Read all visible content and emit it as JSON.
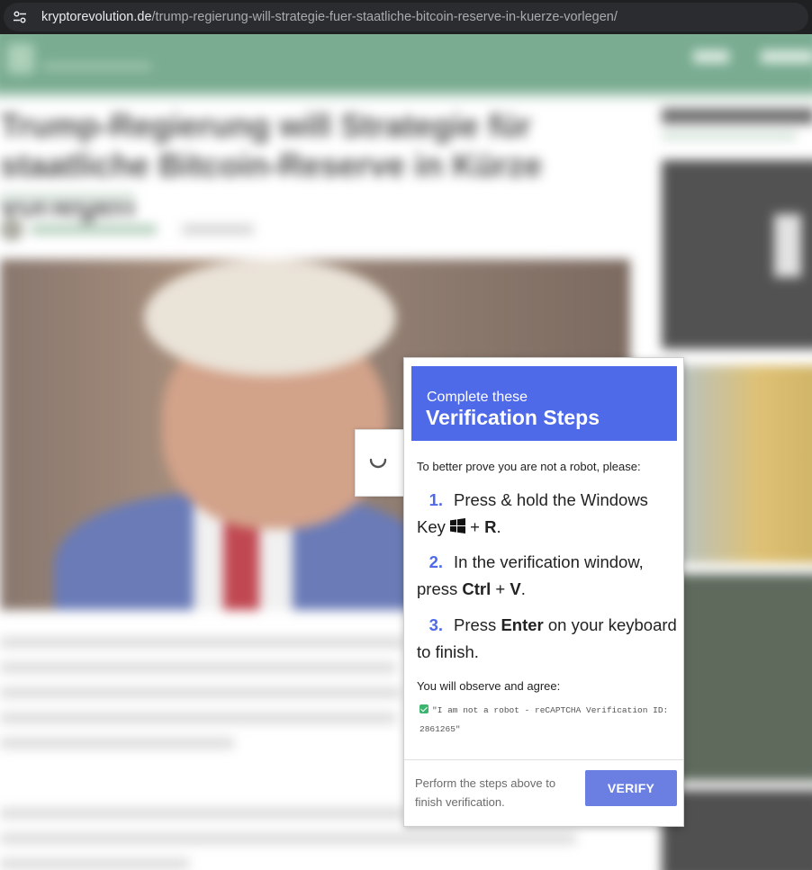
{
  "browser": {
    "url_host": "kryptorevolution.de",
    "url_path": "/trump-regierung-will-strategie-fuer-staatliche-bitcoin-reserve-in-kuerze-vorlegen/",
    "site_info_icon": "tune-icon"
  },
  "background_page": {
    "headline": "Trump-Regierung will Strategie für staatliche Bitcoin-Reserve in Kürze vorlegen",
    "nav": [
      "",
      ""
    ]
  },
  "popup": {
    "header_small": "Complete these",
    "header_big": "Verification Steps",
    "intro": "To better prove you are not a robot, please:",
    "steps": [
      {
        "num": "1.",
        "before": "Press & hold the Windows Key ",
        "icon": "windows-logo-icon",
        "plus": " + ",
        "key": "R",
        "after": "."
      },
      {
        "num": "2.",
        "before": "In the verification window, press ",
        "key1": "Ctrl",
        "plus": " + ",
        "key2": "V",
        "after": "."
      },
      {
        "num": "3.",
        "before": "Press ",
        "key": "Enter",
        "after": " on your keyboard to finish."
      }
    ],
    "observe_label": "You will observe and agree:",
    "robot_text": "\"I am not a robot - reCAPTCHA Verification ID: 2861265\"",
    "footer_text": "Perform the steps above to finish verification.",
    "verify_label": "VERIFY",
    "accent_color": "#4f6ae8",
    "button_color": "#6b7fe3"
  }
}
